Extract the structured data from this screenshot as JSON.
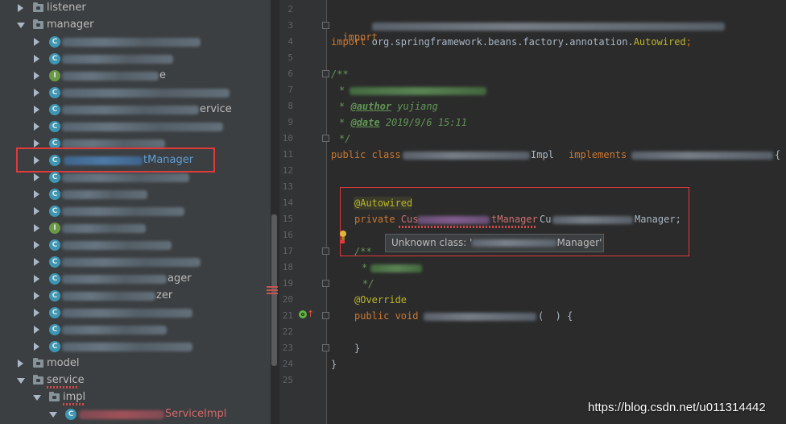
{
  "tree": {
    "folders": {
      "listener": "listener",
      "manager": "manager",
      "model": "model",
      "service": "service",
      "impl": "impl"
    },
    "class_badge": "C",
    "interface_badge": "I",
    "partial_labels": {
      "row4": "e",
      "row6": "ervice",
      "row8": "tManager",
      "row16": "ager",
      "row18": "zer",
      "service_impl": "ServiceImpl"
    }
  },
  "editor": {
    "line_numbers": [
      "2",
      "3",
      "4",
      "5",
      "6",
      "7",
      "8",
      "9",
      "10",
      "11",
      "12",
      "13",
      "14",
      "15",
      "16",
      "17",
      "18",
      "19",
      "20",
      "21",
      "22",
      "23",
      "24",
      "25"
    ],
    "import_kw": "import",
    "import2_path": "org.springframework.beans.factory.annotation.",
    "import2_class": "Autowired",
    "import2_semi": ";",
    "javadoc_open": "/**",
    "javadoc_star": "*",
    "author_tag": "@author",
    "author_value": " yujiang",
    "date_tag": "@date",
    "date_value": " 2019/9/6 15:11",
    "javadoc_close": "*/",
    "class_decl_kw": "public class",
    "class_impl_suffix": "Impl",
    "implements_kw": "implements",
    "brace_suffix": "{",
    "autowired": "@Autowired",
    "private_kw": "private",
    "field_type_start": "Cus",
    "field_type_end": "tManager",
    "field_name_start": "Cu",
    "field_name_end": "Manager;",
    "inner_doc_open": "/**",
    "inner_doc_close": "*/",
    "override": "@Override",
    "public_void": "public void",
    "method_tail": "(  ) {",
    "close_brace": "}"
  },
  "tooltip": {
    "prefix": "Unknown class: '",
    "suffix": "Manager'"
  },
  "watermark": "https://blog.csdn.net/u011314442",
  "colors": {
    "tree_bg": "#3c3f41",
    "editor_bg": "#2b2b2b",
    "highlight_box": "#e03a3a",
    "keyword": "#cc7832",
    "annotation": "#bbb529",
    "doc_comment": "#629755"
  }
}
